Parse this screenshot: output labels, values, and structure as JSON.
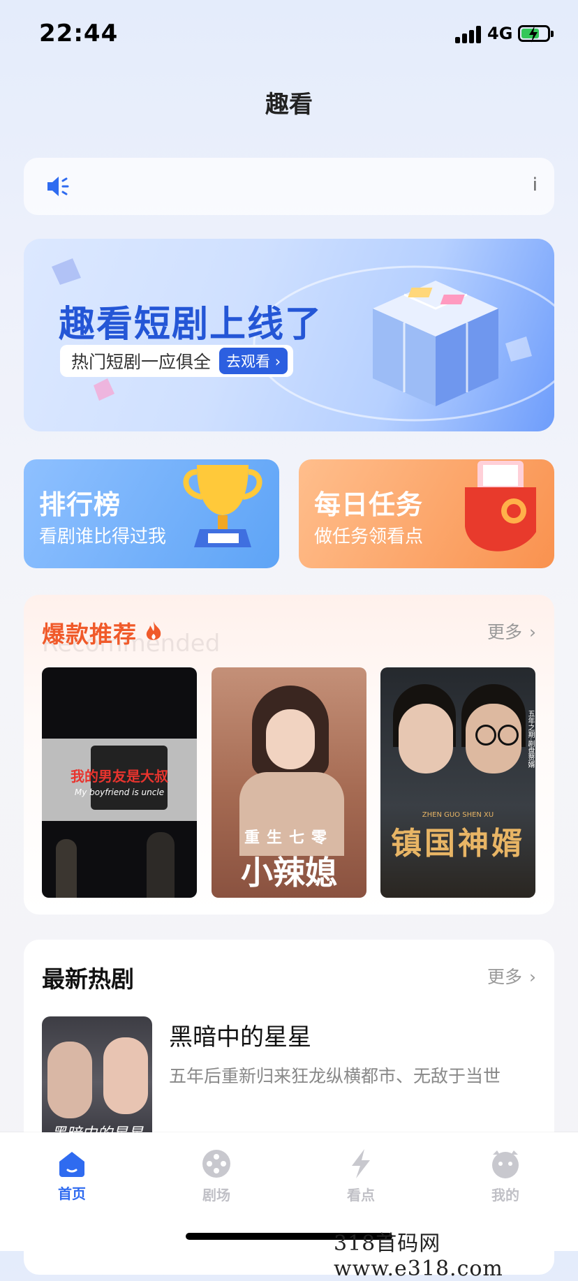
{
  "status_bar": {
    "time": "22:44",
    "network": "4G"
  },
  "page": {
    "title": "趣看"
  },
  "notice": {
    "text": "i"
  },
  "banner": {
    "title": "趣看短剧上线了",
    "subtitle": "热门短剧一应俱全",
    "cta": "去观看 ›"
  },
  "cards": [
    {
      "title": "排行榜",
      "subtitle": "看剧谁比得过我"
    },
    {
      "title": "每日任务",
      "subtitle": "做任务领看点"
    }
  ],
  "recommend": {
    "title": "爆款推荐",
    "ghost": "Recommended",
    "more": "更多",
    "posters": [
      {
        "title": "我的男友是大叔",
        "subtitle": "My boyfriend is uncle"
      },
      {
        "top": "重生七零",
        "title": "小辣媳"
      },
      {
        "tagline": "五年之期·剧盘赘婿",
        "title": "镇国神婿",
        "pinyin": "ZHEN GUO SHEN XU"
      }
    ]
  },
  "newest": {
    "title": "最新热剧",
    "more": "更多",
    "items": [
      {
        "name": "黑暗中的星星",
        "desc": "五年后重新归来狂龙纵横都市、无敌于当世",
        "cover_text": "黑暗中的星星"
      }
    ]
  },
  "tabbar": {
    "items": [
      {
        "label": "首页",
        "icon": "home-icon",
        "active": true
      },
      {
        "label": "剧场",
        "icon": "film-reel-icon",
        "active": false
      },
      {
        "label": "看点",
        "icon": "lightning-icon",
        "active": false
      },
      {
        "label": "我的",
        "icon": "profile-face-icon",
        "active": false
      }
    ]
  },
  "watermark": "318首码网 www.e318.com",
  "colors": {
    "accent": "#2f6bf0",
    "hot": "#f05a2a",
    "rank_card": "#6fb0f8",
    "task_card": "#fba56a"
  }
}
